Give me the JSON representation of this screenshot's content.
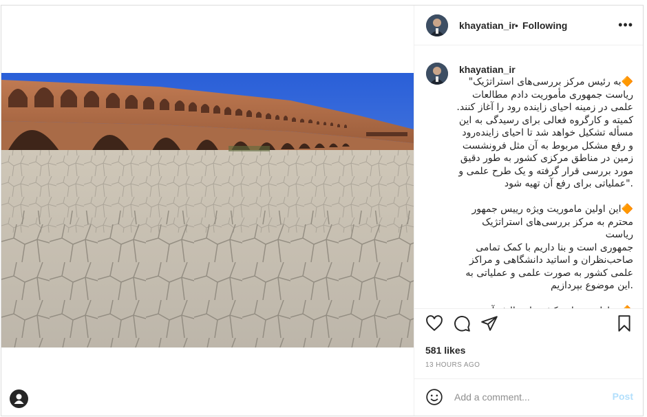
{
  "post": {
    "username": "khayatian_ir",
    "separator": "•",
    "follow_state": "Following",
    "more_icon": "more-icon",
    "caption_lines": "🔶به رئیس مرکز بررسی‌های استراتژیک\"\nریاست جمهوری مأموریت دادم مطالعات\nعلمی در زمینه احیای زاینده رود را آغاز کنند.\nکمیته و کارگروه فعالی برای رسیدگی به این\nمسأله تشکیل خواهد شد تا احیای زاینده‌رود\nو رفع مشکل مربوط به آن مثل فرونشست\nزمین در مناطق مرکزی کشور به طور دقیق\nمورد بررسی قرار گرفته و یک طرح علمی و\n.\"عملیاتی برای رفع آن تهیه شود\n\n🔶این اولین ماموریت ویژه رییس جمهور\nمحترم به مرکز بررسی‌های استراتژیک ریاست\nجمهوری است و بنا داریم با کمک تمامی\nصاحب‌نظران و اساتید دانشگاهی و مراکز\nعلمی کشور به صورت علمی و عملیاتی به\n.این موضوع بپردازیم\n\n🔶 مناطق مختلف کشور از چالش آب رنج",
    "likes": "581 likes",
    "time": "13 HOURS AGO",
    "comment_placeholder": "Add a comment...",
    "post_label": "Post"
  },
  "colors": {
    "border": "#dbdbdb",
    "muted": "#8e8e8e",
    "post_disabled": "#b2dffc",
    "sky": "#2f63d6",
    "brick": "#b06a45"
  }
}
